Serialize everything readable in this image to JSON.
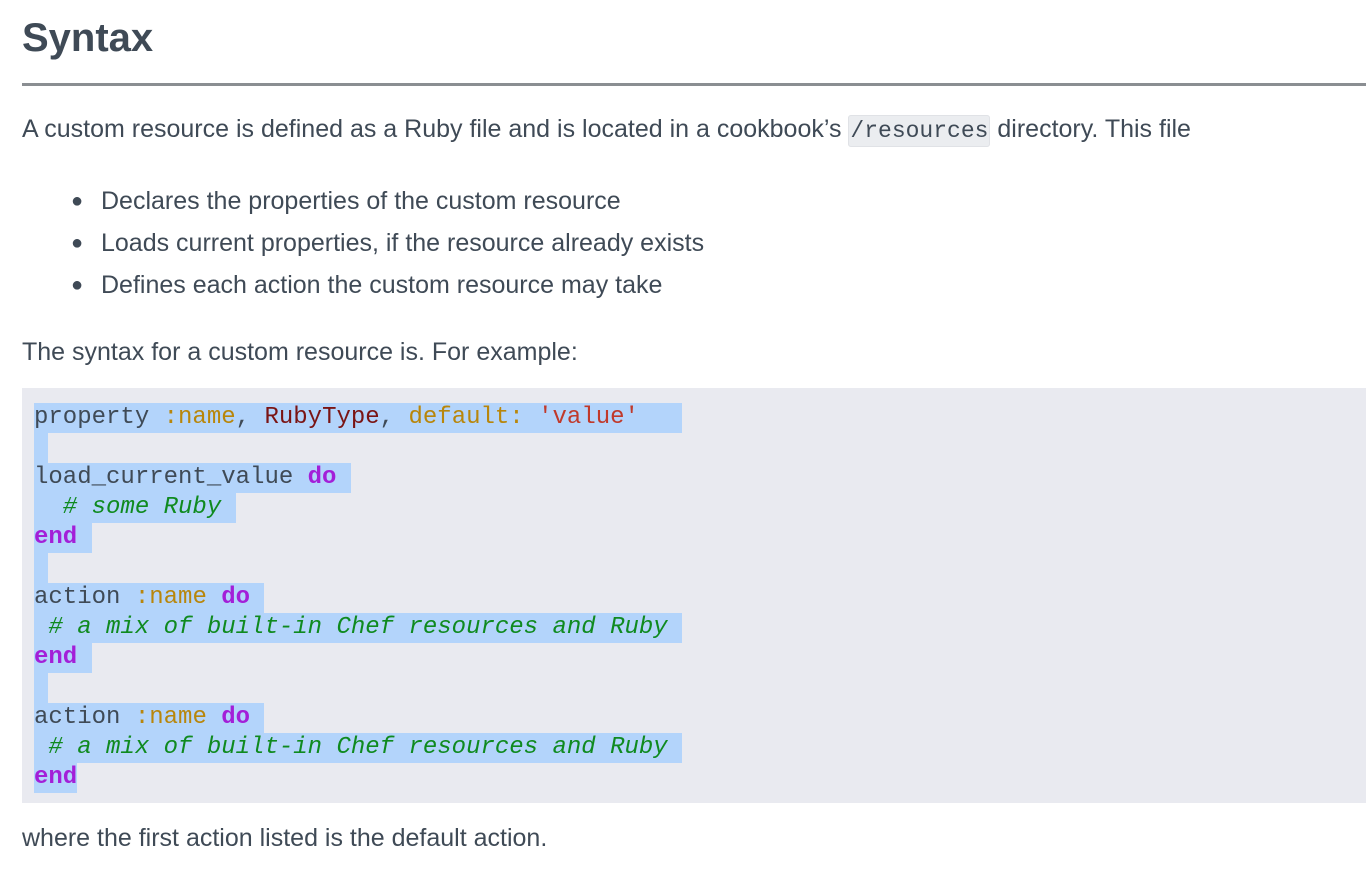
{
  "heading": "Syntax",
  "intro": {
    "before": "A custom resource is defined as a Ruby file and is located in a cookbook’s ",
    "code": "/resources",
    "after": " directory. This file"
  },
  "bullets": [
    "Declares the properties of the custom resource",
    "Loads current properties, if the resource already exists",
    "Defines each action the custom resource may take"
  ],
  "syntax_lead": "The syntax for a custom resource is. For example:",
  "code": {
    "l1": {
      "a": "property ",
      "b": ":name",
      "c": ", ",
      "d": "RubyType",
      "e": ", ",
      "f": "default:",
      "g": " ",
      "h": "'value'",
      "i": " "
    },
    "l3": {
      "a": "load_current_value ",
      "b": "do",
      "c": " "
    },
    "l4": {
      "a": "  # some Ruby "
    },
    "l5": {
      "a": "end"
    },
    "l7": {
      "a": "action ",
      "b": ":name",
      "c": " ",
      "d": "do",
      "e": " "
    },
    "l8": {
      "a": " # a mix of built-in Chef resources and Ruby "
    },
    "l9": {
      "a": "end"
    },
    "l11": {
      "a": "action ",
      "b": ":name",
      "c": " ",
      "d": "do",
      "e": " "
    },
    "l12": {
      "a": " # a mix of built-in Chef resources and Ruby "
    },
    "l13": {
      "a": "end"
    }
  },
  "outro": "where the first action listed is the default action."
}
